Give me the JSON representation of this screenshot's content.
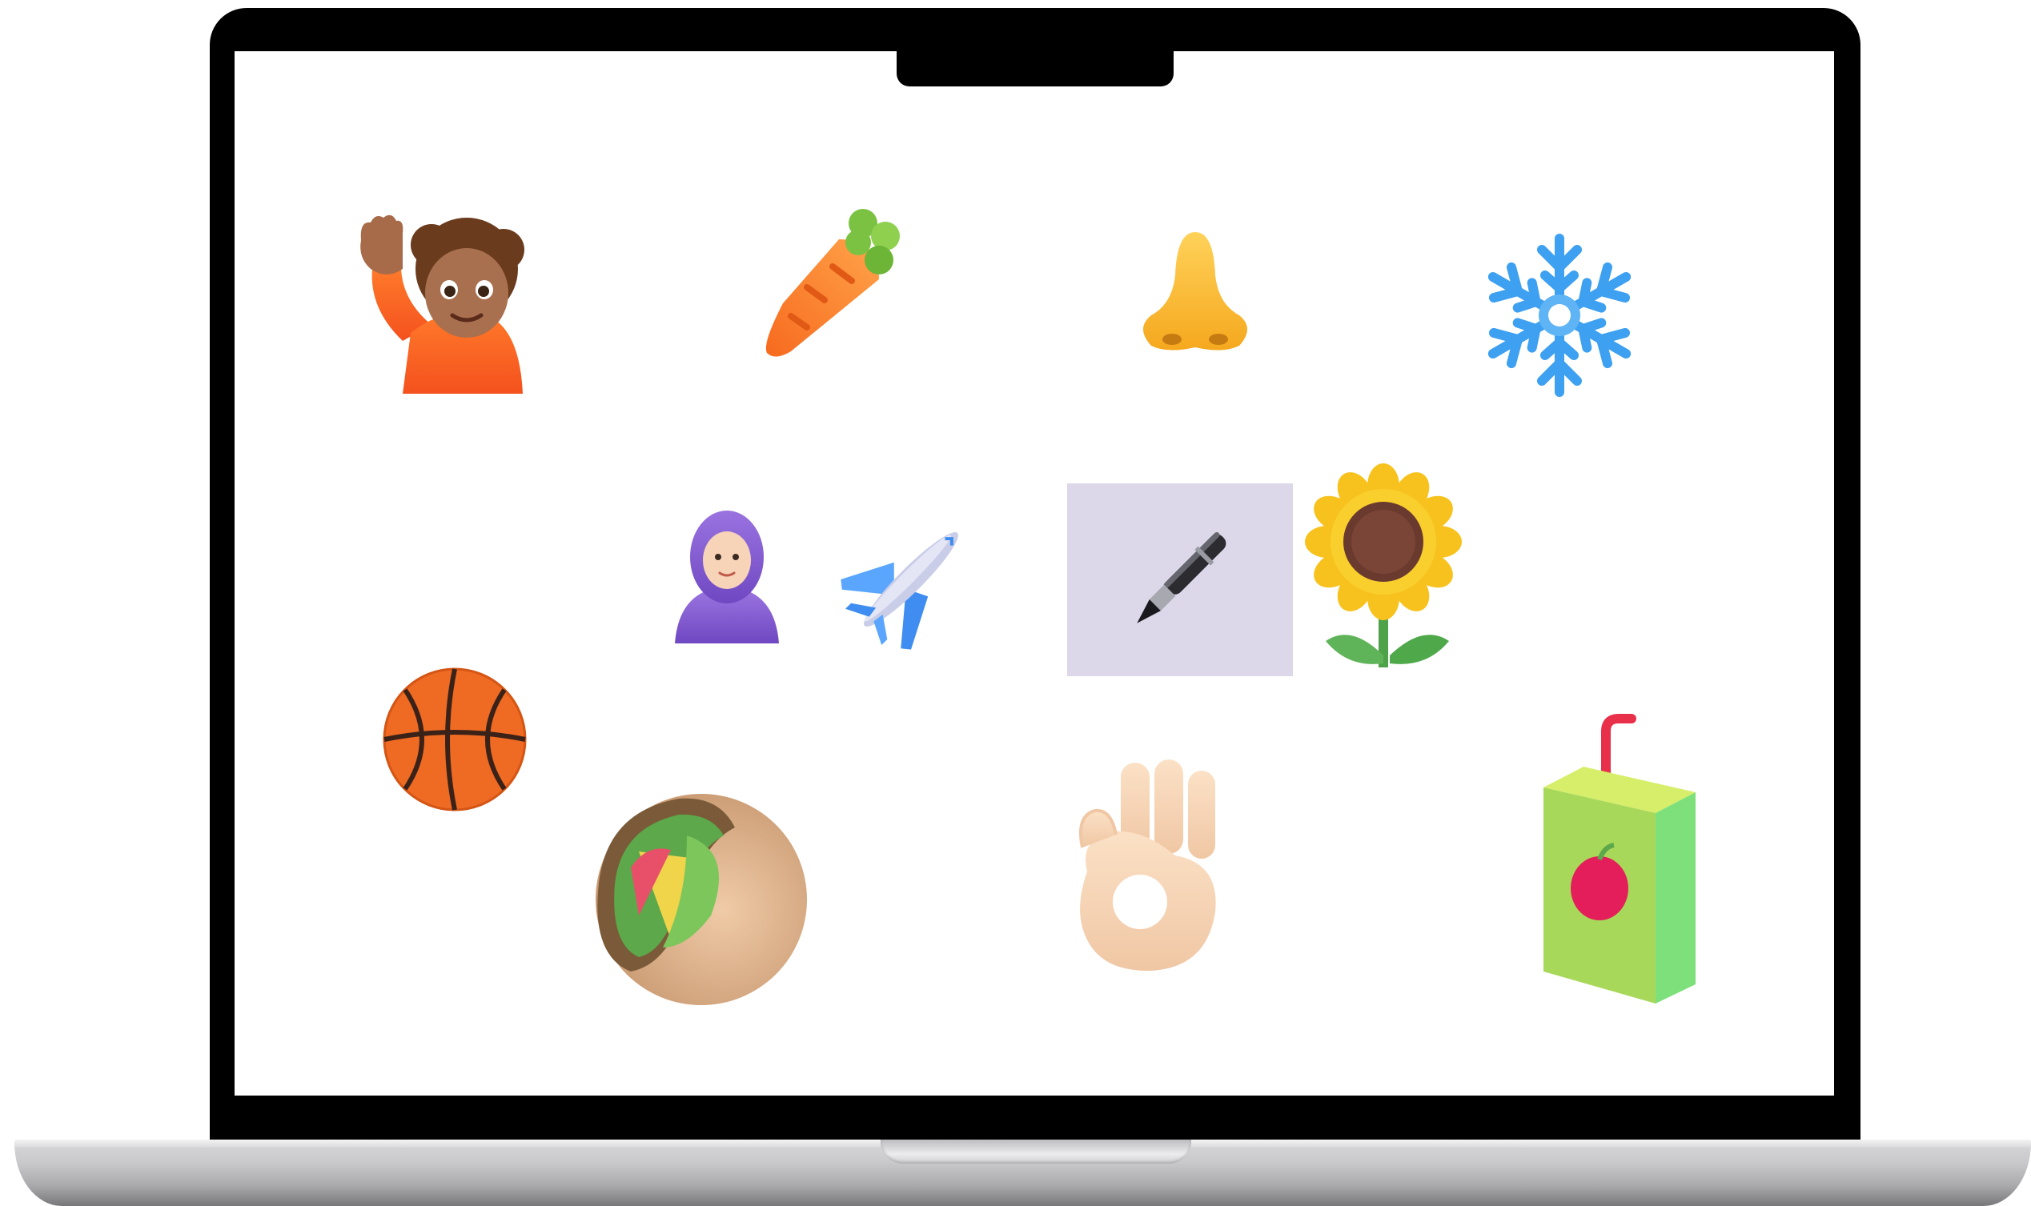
{
  "device": {
    "type": "laptop",
    "screen_background": "#ffffff"
  },
  "selection_color": "#dcd8ea",
  "items": [
    {
      "icon": "person-raising-hand-icon",
      "selected": false
    },
    {
      "icon": "carrot-icon",
      "selected": false
    },
    {
      "icon": "nose-icon",
      "selected": false
    },
    {
      "icon": "snowflake-icon",
      "selected": false
    },
    {
      "icon": "woman-with-headscarf-icon",
      "selected": false
    },
    {
      "icon": "airplane-icon",
      "selected": false
    },
    {
      "icon": "pen-icon",
      "selected": true
    },
    {
      "icon": "sunflower-icon",
      "selected": false
    },
    {
      "icon": "basketball-icon",
      "selected": false
    },
    {
      "icon": "stuffed-flatbread-icon",
      "selected": false
    },
    {
      "icon": "ok-hand-icon",
      "selected": false
    },
    {
      "icon": "juice-box-icon",
      "selected": false
    }
  ]
}
